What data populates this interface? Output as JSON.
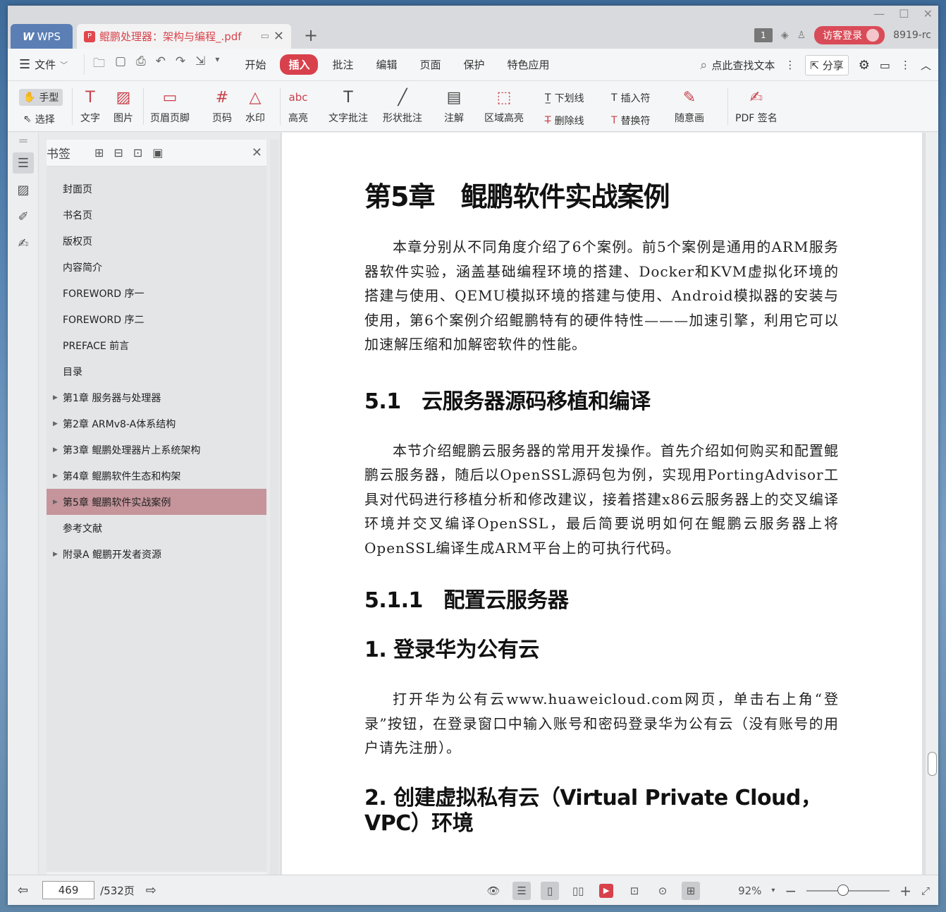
{
  "titlebar": {
    "app_tab": "WPS",
    "doc_tab": "鲲鹏处理器：架构与编程_.pdf",
    "page_badge": "1",
    "guest_login": "访客登录",
    "version": "8919-rc"
  },
  "menubar": {
    "file": "文件",
    "items": [
      "开始",
      "插入",
      "批注",
      "编辑",
      "页面",
      "保护",
      "特色应用"
    ],
    "active": "插入",
    "search": "点此查找文本",
    "share": "分享"
  },
  "ribbon": {
    "hand": "手型",
    "select": "选择",
    "text": "文字",
    "image": "图片",
    "header_footer": "页眉页脚",
    "page_number": "页码",
    "watermark": "水印",
    "highlight": "高亮",
    "text_comment": "文字批注",
    "shape_comment": "形状批注",
    "note": "注解",
    "area_highlight": "区域高亮",
    "underline": "下划线",
    "strikethrough": "删除线",
    "insert_mark": "插入符",
    "replace_mark": "替换符",
    "freehand": "随意画",
    "pdf_sign": "PDF 签名"
  },
  "bookmarks": {
    "title": "书签",
    "items": [
      {
        "label": "封面页",
        "expandable": false
      },
      {
        "label": "书名页",
        "expandable": false
      },
      {
        "label": "版权页",
        "expandable": false
      },
      {
        "label": "内容简介",
        "expandable": false
      },
      {
        "label": "FOREWORD 序一",
        "expandable": false
      },
      {
        "label": "FOREWORD 序二",
        "expandable": false
      },
      {
        "label": "PREFACE 前言",
        "expandable": false
      },
      {
        "label": "目录",
        "expandable": false
      },
      {
        "label": "第1章 服务器与处理器",
        "expandable": true
      },
      {
        "label": "第2章 ARMv8-A体系结构",
        "expandable": true
      },
      {
        "label": "第3章 鲲鹏处理器片上系统架构",
        "expandable": true
      },
      {
        "label": "第4章 鲲鹏软件生态和构架",
        "expandable": true
      },
      {
        "label": "第5章 鲲鹏软件实战案例",
        "expandable": true
      },
      {
        "label": "参考文献",
        "expandable": false
      },
      {
        "label": "附录A 鲲鹏开发者资源",
        "expandable": true
      }
    ],
    "active_index": 12
  },
  "document": {
    "chapter_title": "第5章　鲲鹏软件实战案例",
    "chapter_intro": "本章分别从不同角度介绍了6个案例。前5个案例是通用的ARM服务器软件实验，涵盖基础编程环境的搭建、Docker和KVM虚拟化环境的搭建与使用、QEMU模拟环境的搭建与使用、Android模拟器的安装与使用，第6个案例介绍鲲鹏特有的硬件特性———加速引擎，利用它可以加速解压缩和加解密软件的性能。",
    "section_5_1": "5.1　云服务器源码移植和编译",
    "section_5_1_para": "本节介绍鲲鹏云服务器的常用开发操作。首先介绍如何购买和配置鲲鹏云服务器，随后以OpenSSL源码包为例，实现用PortingAdvisor工具对代码进行移植分析和修改建议，接着搭建x86云服务器上的交叉编译环境并交叉编译OpenSSL，最后简要说明如何在鲲鹏云服务器上将OpenSSL编译生成ARM平台上的可执行代码。",
    "section_5_1_1": "5.1.1　配置云服务器",
    "step1_title": "1. 登录华为公有云",
    "step1_para": "打开华为公有云www.huaweicloud.com网页，单击右上角“登录”按钮，在登录窗口中输入账号和密码登录华为公有云（没有账号的用户请先注册）。",
    "step2_title": "2. 创建虚拟私有云（Virtual Private Cloud，VPC）环境"
  },
  "statusbar": {
    "current_page": "469",
    "total_pages": "/532页",
    "zoom": "92%",
    "zoom_fraction": 0.4
  }
}
